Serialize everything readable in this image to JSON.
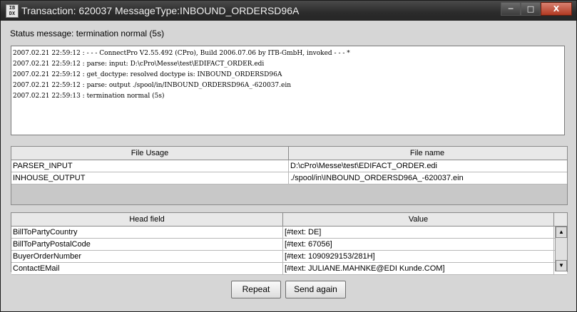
{
  "window": {
    "title": "Transaction: 620037 MessageType:INBOUND_ORDERSD96A",
    "minimize": "─",
    "maximize": "□",
    "close": "X"
  },
  "status_message": "Status message: termination normal (5s)",
  "log_lines": [
    "2007.02.21 22:59:12 : - - - ConnectPro V2.55.492 (CPro), Build 2006.07.06 by ITB-GmbH, invoked - - - *",
    "2007.02.21 22:59:12 : parse: input: D:\\cPro\\Messe\\test\\EDIFACT_ORDER.edi",
    "2007.02.21 22:59:12 : get_doctype: resolved doctype is: INBOUND_ORDERSD96A",
    "2007.02.21 22:59:12 : parse: output ./spool/in/INBOUND_ORDERSD96A_-620037.ein",
    "2007.02.21 22:59:13 : termination normal (5s)"
  ],
  "file_table": {
    "headers": [
      "File Usage",
      "File name"
    ],
    "rows": [
      [
        "PARSER_INPUT",
        "D:\\cPro\\Messe\\test\\EDIFACT_ORDER.edi"
      ],
      [
        "INHOUSE_OUTPUT",
        "./spool/in\\INBOUND_ORDERSD96A_-620037.ein"
      ]
    ]
  },
  "head_table": {
    "headers": [
      "Head field",
      "Value"
    ],
    "rows": [
      [
        "BillToPartyCountry",
        "[#text: DE]"
      ],
      [
        "BillToPartyPostalCode",
        "[#text: 67056]"
      ],
      [
        "BuyerOrderNumber",
        "[#text: 1090929153/281H]"
      ],
      [
        "ContactEMail",
        "[#text: JULIANE.MAHNKE@EDI Kunde.COM]"
      ]
    ]
  },
  "buttons": {
    "repeat": "Repeat",
    "send_again": "Send again"
  }
}
